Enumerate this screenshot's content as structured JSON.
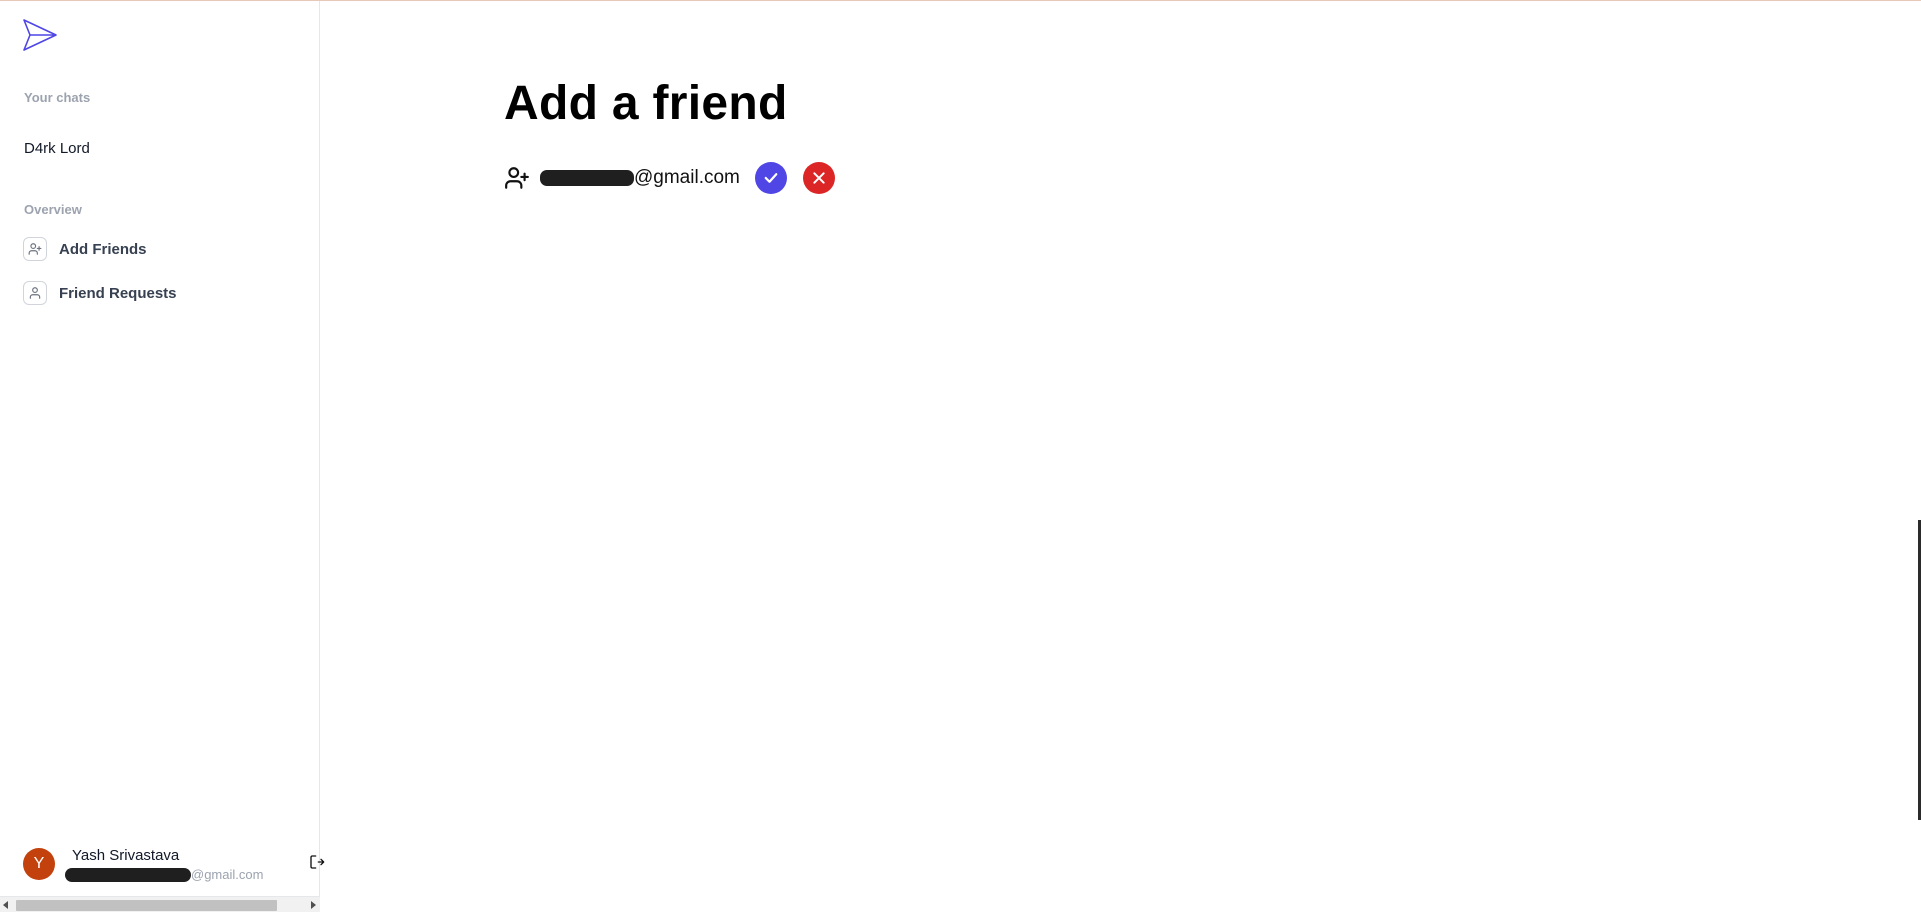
{
  "sidebar": {
    "your_chats_label": "Your chats",
    "chats": [
      {
        "name": "D4rk Lord"
      }
    ],
    "overview_label": "Overview",
    "nav_items": [
      {
        "label": "Add Friends",
        "icon": "user-plus-icon"
      },
      {
        "label": "Friend Requests",
        "icon": "user-icon"
      }
    ],
    "profile": {
      "initial": "Y",
      "name": "Yash Srivastava",
      "email_suffix": "@gmail.com"
    }
  },
  "main": {
    "title": "Add a friend",
    "requests": [
      {
        "email_suffix": "@gmail.com"
      }
    ]
  },
  "colors": {
    "accent": "#4f46e5",
    "danger": "#dc2626",
    "avatar": "#c2410c"
  }
}
